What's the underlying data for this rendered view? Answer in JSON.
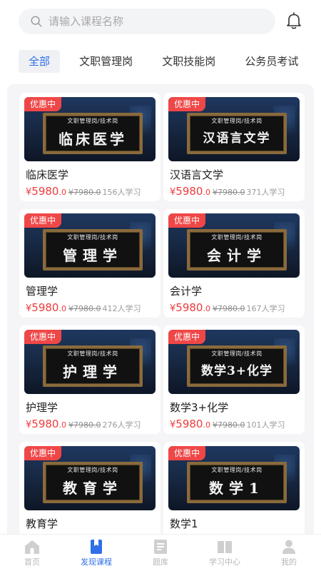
{
  "search": {
    "placeholder": "请输入课程名称"
  },
  "tabs": [
    {
      "label": "全部",
      "active": true
    },
    {
      "label": "文职管理岗",
      "active": false
    },
    {
      "label": "文职技能岗",
      "active": false
    },
    {
      "label": "公务员考试",
      "active": false
    }
  ],
  "courses": [
    {
      "badge": "优惠中",
      "banner_top": "文职管理岗/技术岗",
      "banner_title": "临床医学",
      "title": "临床医学",
      "price_currency": "¥",
      "price_int": "5980",
      "price_dec": ".0",
      "original_price": "¥7980.0",
      "learners": "156人学习"
    },
    {
      "badge": "优惠中",
      "banner_top": "文职管理岗/技术岗",
      "banner_title": "汉语言文学",
      "title": "汉语言文学",
      "price_currency": "¥",
      "price_int": "5980",
      "price_dec": ".0",
      "original_price": "¥7980.0",
      "learners": "371人学习"
    },
    {
      "badge": "优惠中",
      "banner_top": "文职管理岗/技术岗",
      "banner_title": "管理学",
      "title": "管理学",
      "price_currency": "¥",
      "price_int": "5980",
      "price_dec": ".0",
      "original_price": "¥7980.0",
      "learners": "412人学习"
    },
    {
      "badge": "优惠中",
      "banner_top": "文职管理岗/技术岗",
      "banner_title": "会计学",
      "title": "会计学",
      "price_currency": "¥",
      "price_int": "5980",
      "price_dec": ".0",
      "original_price": "¥7980.0",
      "learners": "167人学习"
    },
    {
      "badge": "优惠中",
      "banner_top": "文职管理岗/技术岗",
      "banner_title": "护理学",
      "title": "护理学",
      "price_currency": "¥",
      "price_int": "5980",
      "price_dec": ".0",
      "original_price": "¥7980.0",
      "learners": "276人学习"
    },
    {
      "badge": "优惠中",
      "banner_top": "文职管理岗/技术岗",
      "banner_title": "数学3+化学",
      "title": "数学3+化学",
      "price_currency": "¥",
      "price_int": "5980",
      "price_dec": ".0",
      "original_price": "¥7980.0",
      "learners": "101人学习"
    },
    {
      "badge": "优惠中",
      "banner_top": "文职管理岗/技术岗",
      "banner_title": "教育学",
      "title": "教育学"
    },
    {
      "badge": "优惠中",
      "banner_top": "文职管理岗/技术岗",
      "banner_title": "数学1",
      "title": "数学1"
    }
  ],
  "bottom_nav": [
    {
      "label": "首页",
      "icon": "home-icon",
      "active": false
    },
    {
      "label": "发现课程",
      "icon": "bookmark-book-icon",
      "active": true
    },
    {
      "label": "题库",
      "icon": "question-bank-icon",
      "active": false
    },
    {
      "label": "学习中心",
      "icon": "open-book-icon",
      "active": false
    },
    {
      "label": "我的",
      "icon": "user-icon",
      "active": false
    }
  ],
  "colors": {
    "accent": "#2f6fe8",
    "price": "#ef3b3b",
    "badge": "#ef4747"
  }
}
